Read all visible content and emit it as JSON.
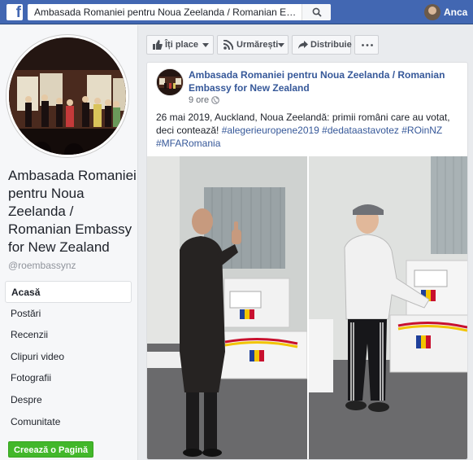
{
  "topbar": {
    "logo": "f",
    "search_value": "Ambasada Romaniei pentru Noua Zeelanda / Romanian Embassy for New Zealand",
    "user_name": "Anca"
  },
  "sidebar": {
    "page_name": "Ambasada Romaniei pentru Noua Zeelanda / Romanian Embassy for New Zealand",
    "handle": "@roembassynz",
    "nav": [
      "Acasă",
      "Postări",
      "Recenzii",
      "Clipuri video",
      "Fotografii",
      "Despre",
      "Comunitate"
    ],
    "create_page": "Creează o Pagină"
  },
  "actions": {
    "like": "Îți place",
    "follow": "Urmărești",
    "share": "Distribuie"
  },
  "post": {
    "author": "Ambasada Romaniei pentru Noua Zeelanda / Romanian Embassy for New Zealand",
    "time": "9 ore",
    "text": "26 mai 2019, Auckland, Noua Zeelandă: primii români care au votat, deci contează!",
    "hashtags": "#alegerieuropene2019 #dedataastavotez #ROinNZ #MFARomania"
  },
  "colors": {
    "topbar": "#4267b2",
    "link": "#365899",
    "create": "#42b72a"
  }
}
